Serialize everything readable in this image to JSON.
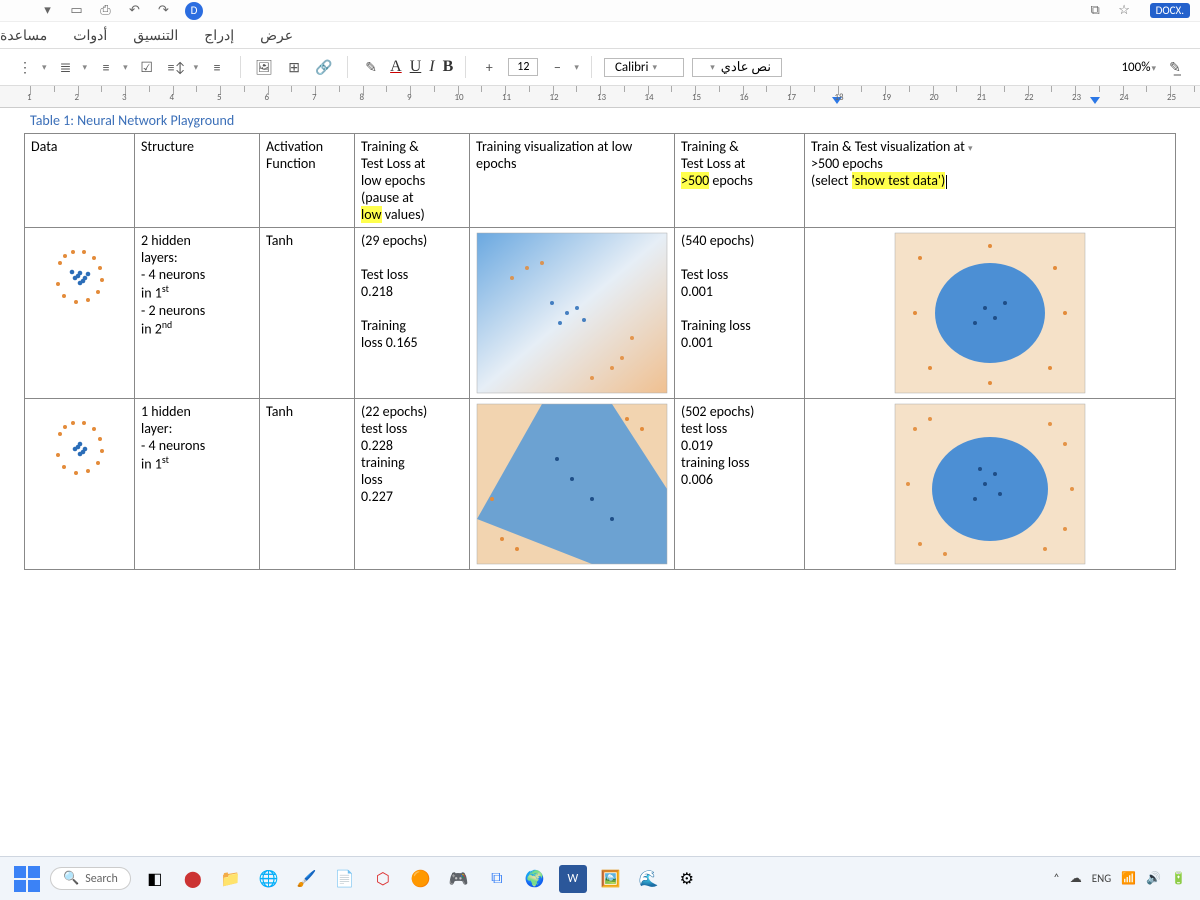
{
  "topbar": {
    "doc_label": "DOCX."
  },
  "menu": {
    "items": [
      "عرض",
      "إدراج",
      "التنسيق",
      "أدوات",
      "مساعدة"
    ]
  },
  "ribbon": {
    "font_size": "12",
    "font_name": "Calibri",
    "style_name": "نص عادي",
    "zoom": "100%"
  },
  "ruler": {
    "numbers": [
      "1",
      "2",
      "3",
      "4",
      "5",
      "6",
      "7",
      "8",
      "9",
      "10",
      "11",
      "12",
      "13",
      "14",
      "15",
      "16",
      "17",
      "18",
      "19",
      "20",
      "21",
      "22",
      "23",
      "24",
      "25"
    ]
  },
  "caption": "Table 1: Neural Network Playground",
  "table": {
    "headers": {
      "data": "Data",
      "structure": "Structure",
      "activation": "Activation Function",
      "low_train": "Training & Test Loss at low epochs (pause at low values)",
      "low_train_l1": "Training &",
      "low_train_l2": "Test Loss at",
      "low_train_l3": "low epochs",
      "low_train_l4": "(pause at",
      "low_train_l5a": "low",
      "low_train_l5b": " values)",
      "low_vis": "Training visualization at low epochs",
      "hi_train_l1": "Training &",
      "hi_train_l2": "Test Loss at",
      "hi_train_l3a": ">500",
      "hi_train_l3b": " epochs",
      "hi_vis_l1": "Train & Test visualization at",
      "hi_vis_l2": ">500 epochs",
      "hi_vis_l3a": "(select ",
      "hi_vis_l3b": "'show test data')"
    },
    "rows": [
      {
        "structure_lines": [
          "2 hidden",
          "layers:",
          "- 4 neurons",
          "in 1",
          "- 2 neurons",
          "in 2"
        ],
        "structure_sup1": "st",
        "structure_sup2": "nd",
        "activation": "Tanh",
        "low_epochs": "(29 epochs)",
        "low_test_label": "Test loss",
        "low_test_val": "0.218",
        "low_train_label": "Training",
        "low_train_val": "loss 0.165",
        "hi_epochs": "(540 epochs)",
        "hi_test_label": "Test loss",
        "hi_test_val": "0.001",
        "hi_train_label": "Training loss",
        "hi_train_val": "0.001"
      },
      {
        "structure_lines": [
          "1 hidden",
          "layer:",
          "- 4 neurons",
          "in 1"
        ],
        "structure_sup1": "st",
        "activation": "Tanh",
        "low_epochs": "(22 epochs)",
        "low_test_label": "test loss",
        "low_test_val": "0.228",
        "low_train_label": "training",
        "low_train_label2": "loss",
        "low_train_val": "0.227",
        "hi_epochs": "(502 epochs)",
        "hi_test_label": "test loss",
        "hi_test_val": "0.019",
        "hi_train_label": "training loss",
        "hi_train_val": "0.006"
      }
    ]
  },
  "taskbar": {
    "search_placeholder": "Search",
    "lang": "ENG"
  },
  "chart_data": [
    {
      "type": "scatter",
      "title": "Data thumbnail (spiral 2-class)",
      "xlim": [
        -6,
        6
      ],
      "ylim": [
        -6,
        6
      ],
      "note": "orange & blue spiral scatter, small preview"
    },
    {
      "type": "heatmap",
      "title": "Row1 low-epoch decision surface",
      "xlim": [
        -6,
        6
      ],
      "ylim": [
        -6,
        6
      ],
      "note": "mostly blue top-left to orange bottom, soft boundary, points overlaid"
    },
    {
      "type": "heatmap",
      "title": "Row1 high-epoch decision surface",
      "xlim": [
        -6,
        6
      ],
      "ylim": [
        -6,
        6
      ],
      "note": "blue circular blob center, orange surround, tight fit"
    },
    {
      "type": "heatmap",
      "title": "Row2 low-epoch decision surface",
      "xlim": [
        -6,
        6
      ],
      "ylim": [
        -6,
        6
      ],
      "note": "diagonal blue band through orange background"
    },
    {
      "type": "heatmap",
      "title": "Row2 high-epoch decision surface",
      "xlim": [
        -6,
        6
      ],
      "ylim": [
        -6,
        6
      ],
      "note": "blue blob center with speckled orange surround"
    }
  ]
}
